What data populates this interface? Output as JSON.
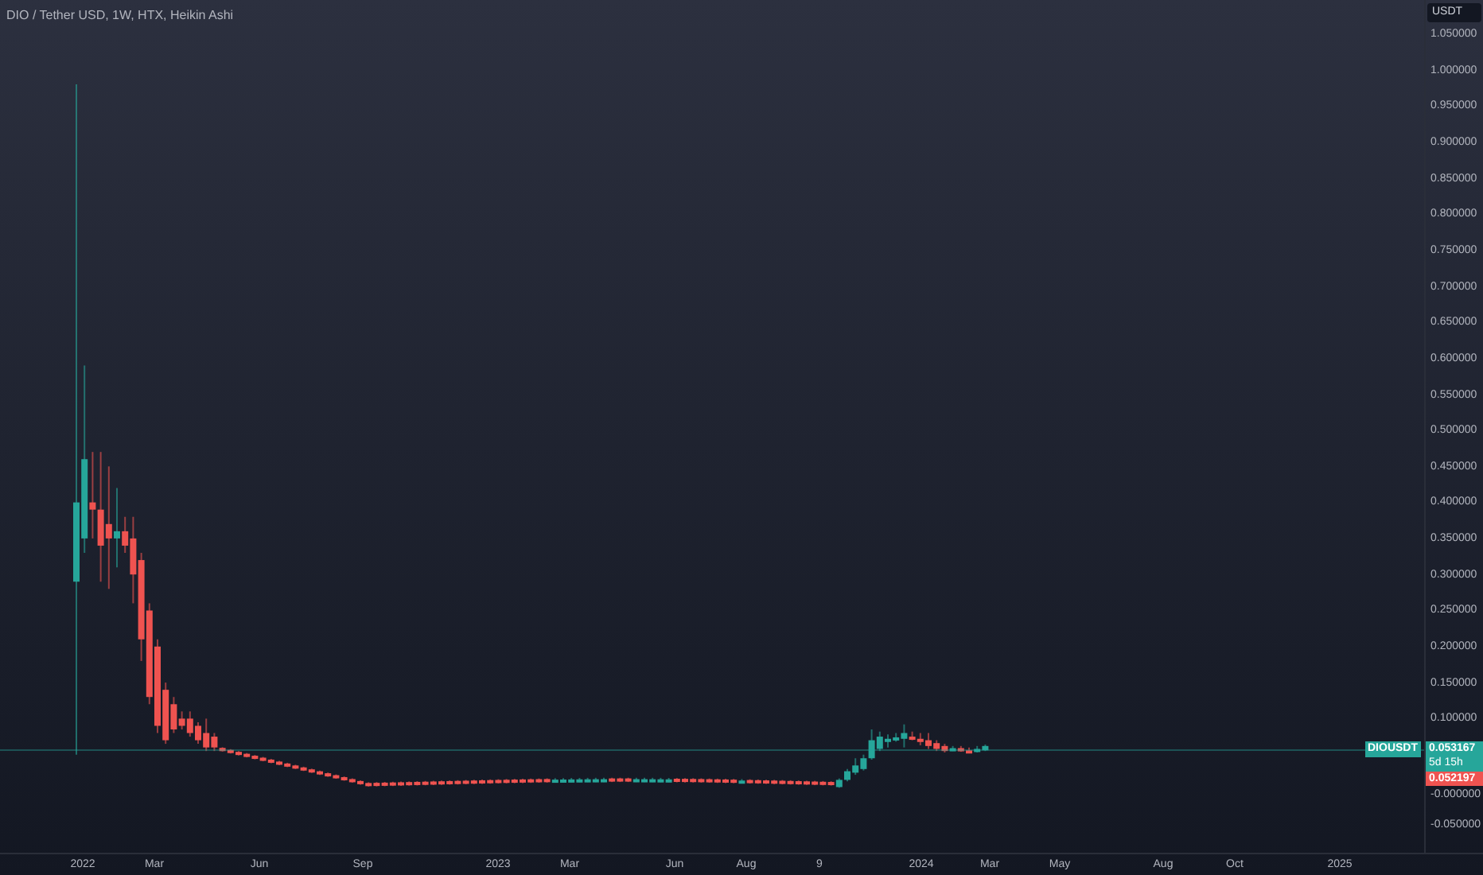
{
  "legend": {
    "title": "DIO / Tether USD, 1W, HTX, Heikin Ashi"
  },
  "price_axis": {
    "currency": "USDT",
    "labels": [
      "1.050000",
      "1.000000",
      "0.950000",
      "0.900000",
      "0.850000",
      "0.800000",
      "0.750000",
      "0.700000",
      "0.650000",
      "0.600000",
      "0.550000",
      "0.500000",
      "0.450000",
      "0.400000",
      "0.350000",
      "0.300000",
      "0.250000",
      "0.200000",
      "0.150000",
      "0.100000",
      "-0.000000",
      "-0.050000"
    ]
  },
  "symbol_tag": "DIOUSDT",
  "last_price": {
    "value": "0.053167",
    "countdown": "5d 15h"
  },
  "prev_price": "0.052197",
  "time_axis": {
    "labels": [
      "2022",
      "Mar",
      "Jun",
      "Sep",
      "2023",
      "Mar",
      "Jun",
      "Aug",
      "9",
      "2024",
      "Mar",
      "May",
      "Aug",
      "Oct",
      "2025"
    ]
  }
}
